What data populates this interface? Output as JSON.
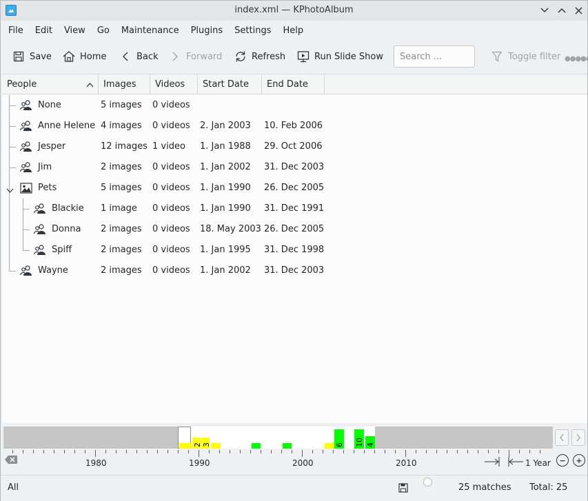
{
  "window": {
    "title": "index.xml — KPhotoAlbum"
  },
  "menu": [
    "File",
    "Edit",
    "View",
    "Go",
    "Maintenance",
    "Plugins",
    "Settings",
    "Help"
  ],
  "toolbar": {
    "save": "Save",
    "home": "Home",
    "back": "Back",
    "forward": "Forward",
    "refresh": "Refresh",
    "slideshow": "Run Slide Show",
    "search_placeholder": "Search ...",
    "toggle_filter": "Toggle filter"
  },
  "columns": [
    "People",
    "Images",
    "Videos",
    "Start Date",
    "End Date"
  ],
  "rows": [
    {
      "name": "None",
      "images": "5 images",
      "videos": "0 videos",
      "start": "",
      "end": "",
      "icon": "people-icon"
    },
    {
      "name": "Anne Helene",
      "images": "4 images",
      "videos": "0 videos",
      "start": "2. Jan 2003",
      "end": "10. Feb 2006",
      "icon": "people-icon"
    },
    {
      "name": "Jesper",
      "images": "12 images",
      "videos": "1 video",
      "start": "1. Jan 1988",
      "end": "29. Oct 2006",
      "icon": "people-icon"
    },
    {
      "name": "Jim",
      "images": "2 images",
      "videos": "0 videos",
      "start": "1. Jan 2002",
      "end": "31. Dec 2003",
      "icon": "people-icon"
    },
    {
      "name": "Pets",
      "images": "5 images",
      "videos": "0 videos",
      "start": "1. Jan 1990",
      "end": "26. Dec 2005",
      "icon": "image-icon"
    },
    {
      "name": "Blackie",
      "images": "1 image",
      "videos": "0 videos",
      "start": "1. Jan 1990",
      "end": "31. Dec 1991",
      "icon": "people-icon"
    },
    {
      "name": "Donna",
      "images": "2 images",
      "videos": "0 videos",
      "start": "18. May 2003",
      "end": "26. Dec 2005",
      "icon": "people-icon"
    },
    {
      "name": "Spiff",
      "images": "2 images",
      "videos": "0 videos",
      "start": "1. Jan 1995",
      "end": "31. Dec 1998",
      "icon": "people-icon"
    },
    {
      "name": "Wayne",
      "images": "2 images",
      "videos": "0 videos",
      "start": "1. Jan 2002",
      "end": "31. Dec 2003",
      "icon": "people-icon"
    }
  ],
  "timeline": {
    "years": [
      "1980",
      "1990",
      "2000",
      "2010"
    ],
    "histogram_labels": [
      "2",
      "3",
      "6",
      "10",
      "4"
    ],
    "unit_label": "1 Year"
  },
  "status": {
    "filter": "All",
    "matches": "25 matches",
    "total": "Total: 25"
  },
  "colors": {
    "accent": "#3daee9",
    "hist_yellow": "#ffff00",
    "hist_green": "#00ff00"
  }
}
